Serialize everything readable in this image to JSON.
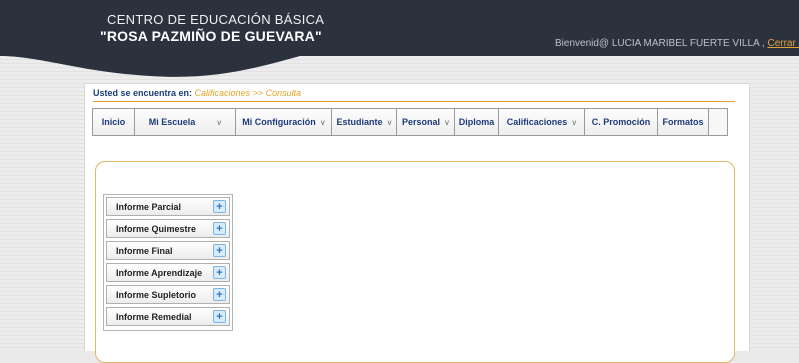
{
  "header": {
    "school_line1": "CENTRO DE EDUCACIÓN BÁSICA",
    "school_line2": "\"ROSA PAZMIÑO DE GUEVARA\"",
    "welcome_text": "Bienvenid@ LUCIA MARIBEL FUERTE VILLA ,",
    "logout_label": "Cerrar sesión"
  },
  "breadcrumb": {
    "prefix": "Usted se encuentra en:",
    "path": "Calificaciones >> Consulta"
  },
  "menu": {
    "items": [
      {
        "label": "Inicio",
        "has_caret": false
      },
      {
        "label": "Mi Escuela",
        "has_caret": true
      },
      {
        "label": "Mi Configuración",
        "has_caret": true
      },
      {
        "label": "Estudiante",
        "has_caret": true
      },
      {
        "label": "Personal",
        "has_caret": true
      },
      {
        "label": "Diploma",
        "has_caret": false
      },
      {
        "label": "Calificaciones",
        "has_caret": true
      },
      {
        "label": "C. Promoción",
        "has_caret": false
      },
      {
        "label": "Formatos",
        "has_caret": false
      }
    ],
    "caret_glyph": "v"
  },
  "reports": {
    "items": [
      {
        "label": "Informe Parcial"
      },
      {
        "label": "Informe Quimestre"
      },
      {
        "label": "Informe Final"
      },
      {
        "label": "Informe Aprendizaje"
      },
      {
        "label": "Informe Supletorio"
      },
      {
        "label": "Informe Remedial"
      }
    ],
    "icon": "plus-icon"
  },
  "colors": {
    "header_bg": "#2b323d",
    "accent_orange": "#e3a32a",
    "menu_text": "#1d3a7a"
  }
}
